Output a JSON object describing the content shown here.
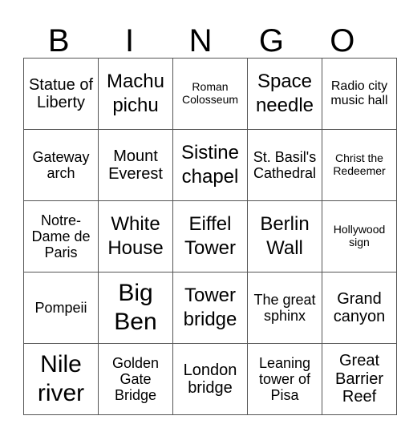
{
  "header": [
    "B",
    "I",
    "N",
    "G",
    "O"
  ],
  "rows": [
    [
      "Statue of Liberty",
      "Machu pichu",
      "Roman Colosseum",
      "Space needle",
      "Radio city music hall"
    ],
    [
      "Gateway arch",
      "Mount Everest",
      "Sistine chapel",
      "St. Basil's Cathedral",
      "Christ the Redeemer"
    ],
    [
      "Notre-Dame de Paris",
      "White House",
      "Eiffel Tower",
      "Berlin Wall",
      "Hollywood sign"
    ],
    [
      "Pompeii",
      "Big Ben",
      "Tower bridge",
      "The great sphinx",
      "Grand canyon"
    ],
    [
      "Nile river",
      "Golden Gate Bridge",
      "London bridge",
      "Leaning tower of Pisa",
      "Great Barrier Reef"
    ]
  ]
}
